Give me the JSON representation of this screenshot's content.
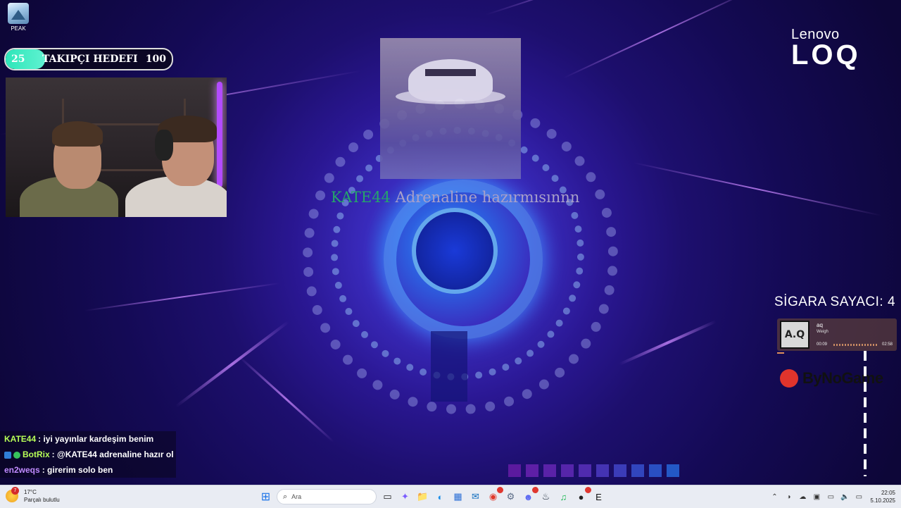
{
  "desktop": {
    "icon_label": "PEAK"
  },
  "follower_goal": {
    "current": "25",
    "label": "TAKIPÇI HEDEFI",
    "target": "100",
    "progress": 0.25,
    "colors": {
      "fill": "#2ee6b9",
      "track": "#0b0724"
    }
  },
  "caption": {
    "name": "KATE44",
    "message": "Adrenaline hazırmısınnn"
  },
  "branding": {
    "line1": "Lenovo",
    "line2": "LOQ"
  },
  "smoke_counter": "SİGARA SAYACI: 4",
  "music": {
    "cover_text": "A.Q",
    "title": "aq",
    "artist": "Weigh",
    "elapsed": "00:09",
    "total": "02:58"
  },
  "logo2": "ByNoGame",
  "chat": [
    {
      "user": "KATE44",
      "text": ": iyi yayınlar kardeşim benim",
      "user_color": "#b7ff57",
      "badges": []
    },
    {
      "user": "BotRix",
      "text": ": @KATE44 adrenaline hazır ol",
      "user_color": "#b7ff57",
      "badges": [
        "bot",
        "verified"
      ]
    },
    {
      "user": "en2weqs",
      "text": ": girerim solo ben",
      "user_color": "#c08bff",
      "badges": []
    }
  ],
  "taskbar": {
    "weather_temp": "17°C",
    "weather_desc": "Parçalı bulutlu",
    "weather_notification": "7",
    "search_placeholder": "Ara",
    "pinned": [
      {
        "name": "copilot",
        "glyph": "✦"
      },
      {
        "name": "file-explorer",
        "glyph": "📁"
      },
      {
        "name": "edge",
        "glyph": "◐"
      },
      {
        "name": "store",
        "glyph": "▦"
      },
      {
        "name": "outlook",
        "glyph": "✉"
      },
      {
        "name": "chrome",
        "glyph": "◉"
      },
      {
        "name": "settings",
        "glyph": "⚙"
      },
      {
        "name": "discord",
        "glyph": "☻"
      },
      {
        "name": "steam",
        "glyph": "♨"
      },
      {
        "name": "spotify",
        "glyph": "♫"
      },
      {
        "name": "obs",
        "glyph": "●"
      },
      {
        "name": "epic-games",
        "glyph": "E"
      }
    ],
    "time": "22:05",
    "date": "5.10.2025"
  },
  "squares_colors": [
    "#5b1a9e",
    "#5e1fa6",
    "#5a22a8",
    "#5625aa",
    "#4f2bae",
    "#4433b3",
    "#3b3cb8",
    "#3145bd",
    "#294fc2",
    "#2358c6"
  ]
}
